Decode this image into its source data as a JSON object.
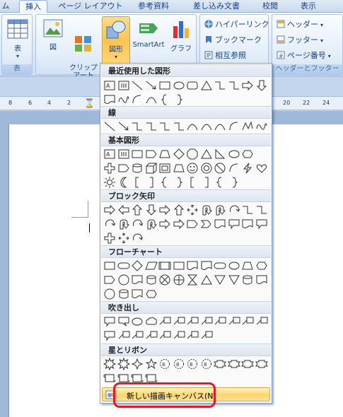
{
  "tabs": [
    {
      "label": "ム"
    },
    {
      "label": "挿入"
    },
    {
      "label": "ページ レイアウト"
    },
    {
      "label": "参考資料"
    },
    {
      "label": "差し込み文書"
    },
    {
      "label": "校閲"
    },
    {
      "label": "表示"
    }
  ],
  "ribbon": {
    "table_group": {
      "button_label": "表",
      "group_label": "表"
    },
    "illustrations": {
      "picture": "図",
      "clipart": "クリップ\nアート",
      "shapes": "図形",
      "smartart": "SmartArt",
      "chart": "グラフ"
    },
    "links": {
      "hyperlink": "ハイパーリンク",
      "bookmark": "ブックマーク",
      "crossref": "相互参照"
    },
    "header_footer": {
      "header": "ヘッダー",
      "footer": "フッター",
      "page_number": "ページ番号",
      "group_label": "ヘッダーとフッター"
    }
  },
  "ruler": {
    "labels": [
      "8",
      "6",
      "4",
      "2",
      "20",
      "22",
      "24"
    ]
  },
  "gallery": {
    "sections": [
      {
        "title": "最近使用した図形"
      },
      {
        "title": "線"
      },
      {
        "title": "基本図形"
      },
      {
        "title": "ブロック矢印"
      },
      {
        "title": "フローチャート"
      },
      {
        "title": "吹き出し"
      },
      {
        "title": "星とリボン"
      }
    ],
    "new_canvas": "新しい描画キャンバス(N)"
  },
  "colors": {
    "accent": "#ffc450",
    "highlight_ring": "#e21a2a",
    "ribbon_text": "#15428b"
  }
}
